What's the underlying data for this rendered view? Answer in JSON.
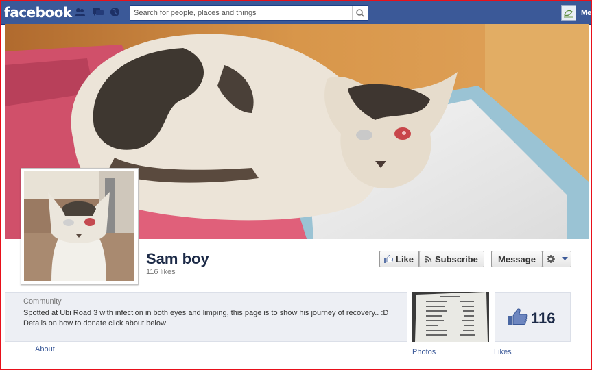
{
  "topbar": {
    "logo": "facebook",
    "search_placeholder": "Search for people, places and things",
    "me_label": "Me"
  },
  "page": {
    "name": "Sam boy",
    "likes_text": "116 likes",
    "buttons": {
      "like": "Like",
      "subscribe": "Subscribe",
      "message": "Message"
    },
    "about": {
      "category": "Community",
      "description": "Spotted at Ubi Road 3 with infection in both eyes and limping, this page is to show his journey of recovery.. :D Details on how to donate click about below",
      "link": "About"
    },
    "apps": {
      "photos_label": "Photos",
      "likes_label": "Likes",
      "likes_count": "116"
    }
  },
  "colors": {
    "topbar": "#3b5998",
    "link": "#3b5998",
    "name": "#1c2a47"
  }
}
